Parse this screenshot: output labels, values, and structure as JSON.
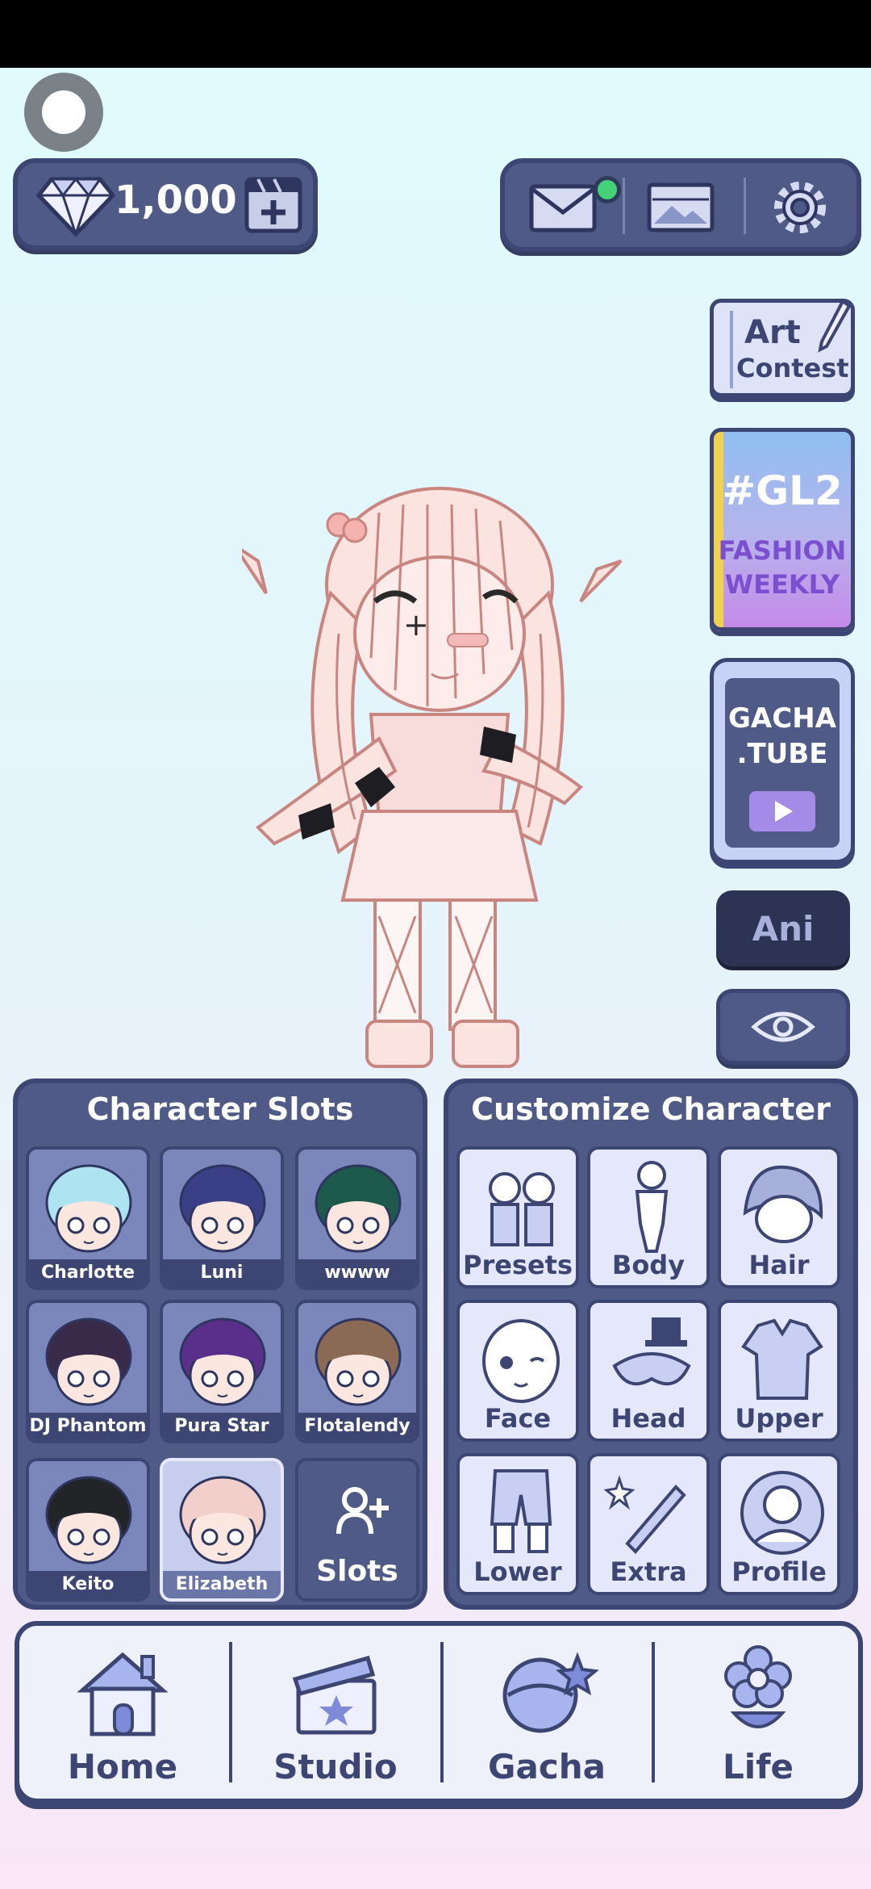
{
  "header": {
    "gems": "1,000"
  },
  "side_cards": {
    "art_contest": {
      "line1": "Art",
      "line2": "Contest"
    },
    "gl2": {
      "tag": "#GL2",
      "line1": "FASHION",
      "line2": "WEEKLY"
    },
    "gacha_tube": {
      "line1": "GACHA",
      "line2": ".TUBE"
    },
    "ani_label": "Ani"
  },
  "character_slots": {
    "title": "Character Slots",
    "slots": [
      {
        "name": "Charlotte",
        "hair": "#aee4f2"
      },
      {
        "name": "Luni",
        "hair": "#3b3f86"
      },
      {
        "name": "wwww",
        "hair": "#1d5a4c"
      },
      {
        "name": "DJ Phantom",
        "hair": "#3a2a4a"
      },
      {
        "name": "Pura Star",
        "hair": "#5a2f8a"
      },
      {
        "name": "Flotalendy",
        "hair": "#8a6a55"
      },
      {
        "name": "Keito",
        "hair": "#232428"
      },
      {
        "name": "Elizabeth",
        "hair": "#f2cfcb"
      }
    ],
    "add_label": "Slots"
  },
  "customize": {
    "title": "Customize Character",
    "items": [
      "Presets",
      "Body",
      "Hair",
      "Face",
      "Head",
      "Upper",
      "Lower",
      "Extra",
      "Profile"
    ]
  },
  "nav": {
    "items": [
      "Home",
      "Studio",
      "Gacha",
      "Life"
    ]
  },
  "colors": {
    "panel": "#4f5a86",
    "outline": "#3d4672",
    "accent_green": "#45d178",
    "gl2_stripe": "#f1d24f"
  }
}
